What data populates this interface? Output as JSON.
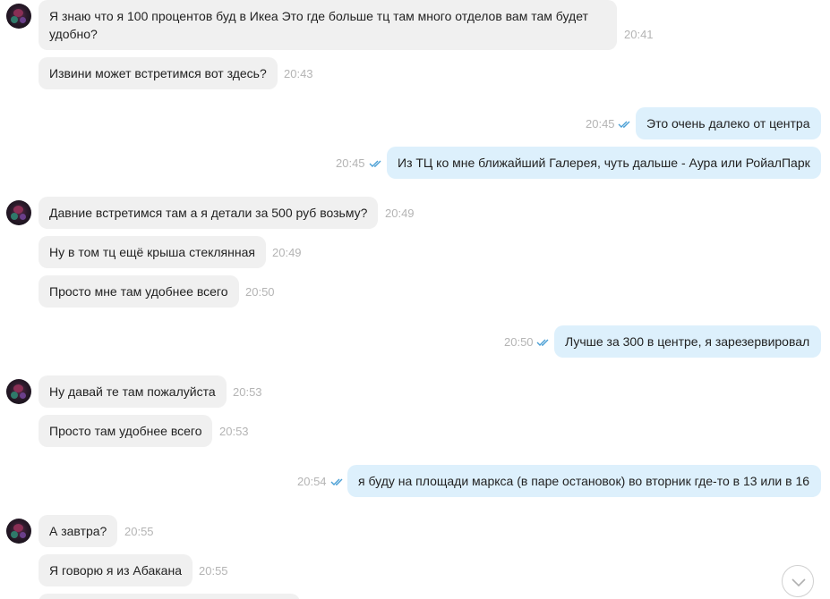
{
  "messages": [
    {
      "text": "Я знаю что я 100 процентов буд в Икеа Это где больше тц там  много отделов вам там будет удобно?",
      "time": "20:41",
      "direction": "in"
    },
    {
      "text": "Извини может встретимся вот здесь?",
      "time": "20:43",
      "direction": "in"
    },
    {
      "text": "Это очень далеко от центра",
      "time": "20:45",
      "direction": "out",
      "read": true
    },
    {
      "text": "Из ТЦ ко мне ближайший Галерея, чуть дальше - Аура или РойалПарк",
      "time": "20:45",
      "direction": "out",
      "read": true
    },
    {
      "text": "Давние встретимся там а я детали за 500 руб возьму?",
      "time": "20:49",
      "direction": "in"
    },
    {
      "text": "Ну в том тц ещё крыша стеклянная",
      "time": "20:49",
      "direction": "in"
    },
    {
      "text": "Просто мне там удобнее всего",
      "time": "20:50",
      "direction": "in"
    },
    {
      "text": "Лучше за 300 в центре, я зарезервировал",
      "time": "20:50",
      "direction": "out",
      "read": true
    },
    {
      "text": "Ну давай те там пожалуйста",
      "time": "20:53",
      "direction": "in"
    },
    {
      "text": "Просто там удобнее всего",
      "time": "20:53",
      "direction": "in"
    },
    {
      "text": "я буду на площади маркса (в паре остановок) во вторник где-то в 13 или в 16",
      "time": "20:54",
      "direction": "out",
      "read": true
    },
    {
      "text": "А завтра?",
      "time": "20:55",
      "direction": "in"
    },
    {
      "text": "Я говорю я из Абакана",
      "time": "20:55",
      "direction": "in"
    }
  ],
  "icons": {
    "read_receipt": "double-check-icon",
    "scroll_down": "chevron-down-icon",
    "avatar": "contact-avatar"
  },
  "colors": {
    "incoming_bubble": "#f0f0f0",
    "outgoing_bubble": "#ddf0fc",
    "timestamp": "#b4b4b4",
    "read_check": "#4a9fd5"
  }
}
